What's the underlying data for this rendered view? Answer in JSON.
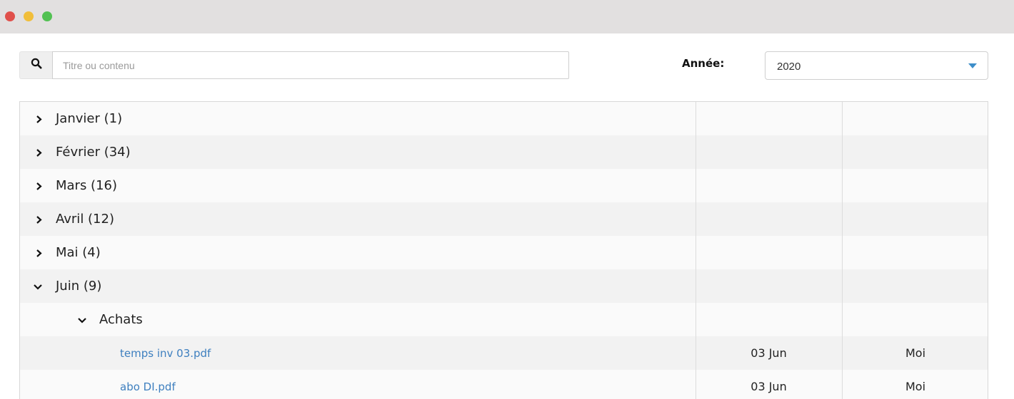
{
  "search": {
    "placeholder": "Titre ou contenu",
    "value": ""
  },
  "year_filter": {
    "label": "Année:",
    "selected": "2020"
  },
  "colors": {
    "link": "#3e7fbf",
    "caret": "#3d8ec9",
    "stripe": "#f2f2f2",
    "titlebar": "#e2e0e0"
  },
  "icons": {
    "search": "search-icon",
    "collapsed": "chevron-right-icon",
    "expanded": "chevron-down-icon",
    "dropdown": "caret-down-icon"
  },
  "months": [
    {
      "label": "Janvier (1)",
      "expanded": false
    },
    {
      "label": "Février (34)",
      "expanded": false
    },
    {
      "label": "Mars (16)",
      "expanded": false
    },
    {
      "label": "Avril (12)",
      "expanded": false
    },
    {
      "label": "Mai (4)",
      "expanded": false
    },
    {
      "label": "Juin (9)",
      "expanded": true
    }
  ],
  "folder": {
    "label": "Achats",
    "expanded": true
  },
  "files": [
    {
      "name": "temps inv 03.pdf",
      "date": "03 Jun",
      "owner": "Moi"
    },
    {
      "name": "abo DI.pdf",
      "date": "03 Jun",
      "owner": "Moi"
    }
  ]
}
